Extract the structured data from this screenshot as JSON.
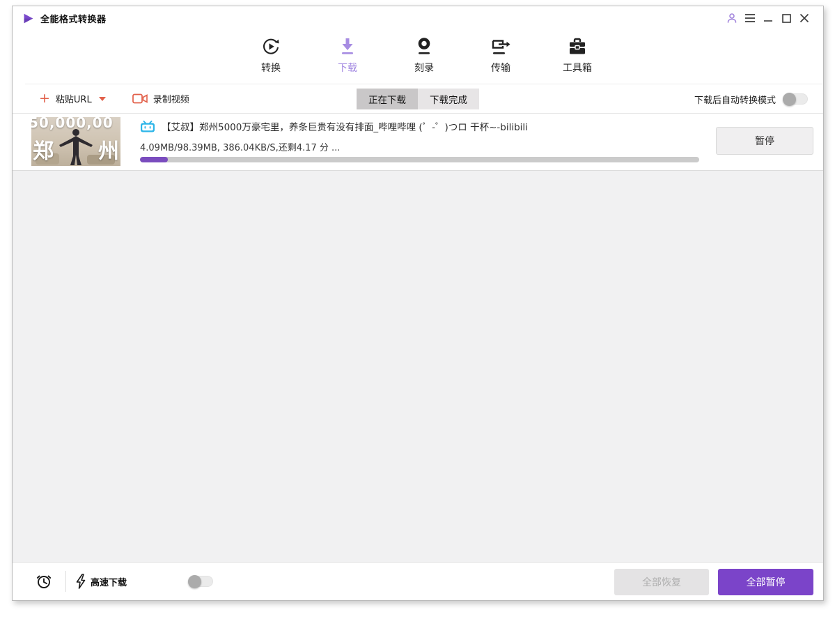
{
  "window": {
    "title": "全能格式转换器"
  },
  "nav": {
    "tabs": [
      {
        "label": "转换",
        "active": false
      },
      {
        "label": "下载",
        "active": true
      },
      {
        "label": "刻录",
        "active": false
      },
      {
        "label": "传输",
        "active": false
      },
      {
        "label": "工具箱",
        "active": false
      }
    ]
  },
  "toolbar": {
    "paste_url_label": "粘贴URL",
    "record_video_label": "录制视频",
    "tabs": [
      {
        "label": "正在下载",
        "active": true
      },
      {
        "label": "下载完成",
        "active": false
      }
    ],
    "auto_convert_label": "下载后自动转换模式",
    "auto_convert_on": false
  },
  "download_item": {
    "source": "bilibili",
    "title": "【艾叔】郑州5000万豪宅里，养条巨贵有没有排面_哔哩哔哩 (゜-゜)つロ 干杯~-bilibili",
    "progress_text": "4.09MB/98.39MB, 386.04KB/S,还剩4.17 分 ...",
    "downloaded": "4.09MB",
    "total_size": "98.39MB",
    "speed": "386.04KB/S",
    "time_left": "4.17 分",
    "progress_percent": 5,
    "pause_label": "暂停",
    "thumbnail": {
      "overlay_top": "50,000,00",
      "overlay_left": "郑",
      "overlay_right": "州"
    }
  },
  "footer": {
    "speed_label": "高速下载",
    "speed_on": false,
    "resume_all_label": "全部恢复",
    "pause_all_label": "全部暂停"
  },
  "colors": {
    "accent_purple": "#7b44c9",
    "active_tab_purple": "#a389e2",
    "underline_purple": "#7e57cc",
    "toolbar_orange": "#e2604a",
    "bilibili_blue": "#2cb5e8",
    "progress_fill": "#7a4cbe",
    "progress_track": "#cbcbcb",
    "list_background": "#f1f1f2"
  }
}
